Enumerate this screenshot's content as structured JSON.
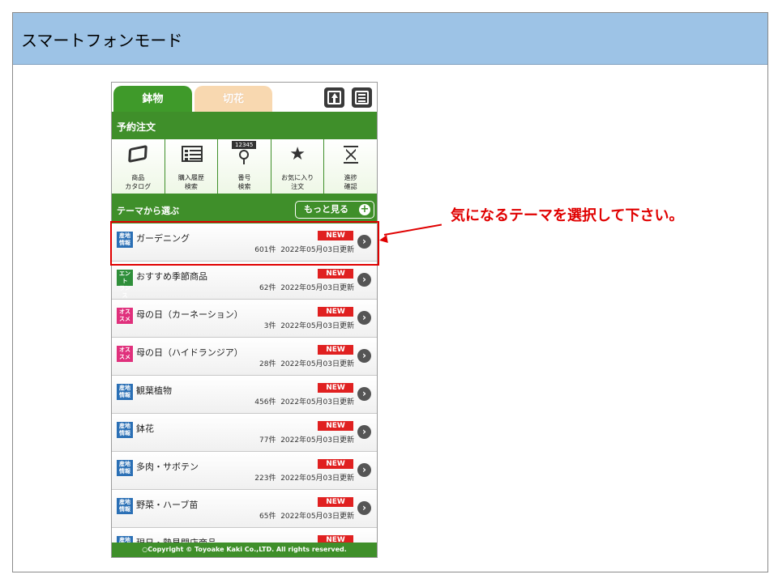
{
  "slide": {
    "title": "スマートフォンモード"
  },
  "tabs": [
    {
      "label": "鉢物",
      "active": true
    },
    {
      "label": "切花",
      "active": false
    }
  ],
  "section_title": "予約注文",
  "nav": [
    {
      "icon": "catalog-icon",
      "label_line1": "商品",
      "label_line2": "カタログ"
    },
    {
      "icon": "history-list-icon",
      "label_line1": "購入履歴",
      "label_line2": "検索"
    },
    {
      "icon": "number-search-icon",
      "num": "12345",
      "label_line1": "番号",
      "label_line2": "検索"
    },
    {
      "icon": "star-icon",
      "label_line1": "お気に入り",
      "label_line2": "注文"
    },
    {
      "icon": "hourglass-icon",
      "label_line1": "進捗",
      "label_line2": "確認"
    }
  ],
  "theme": {
    "label": "テーマから選ぶ",
    "more_label": "もっと見る"
  },
  "items": [
    {
      "badge": "産地情報",
      "badge_line1": "産地",
      "badge_line2": "情報",
      "badge_color": "#2a6fb5",
      "title": "ガーデニング",
      "count": "601件",
      "date": "2022年05月03日更新",
      "new": "NEW"
    },
    {
      "badge": "エントランス",
      "badge_line1": "エント",
      "badge_line2": "ランス",
      "badge_color": "#2f8f3a",
      "title": "おすすめ季節商品",
      "count": "62件",
      "date": "2022年05月03日更新",
      "new": "NEW"
    },
    {
      "badge": "オススメ",
      "badge_line1": "オス",
      "badge_line2": "スメ",
      "badge_color": "#e0307c",
      "title": "母の日（カーネーション）",
      "count": "3件",
      "date": "2022年05月03日更新",
      "new": "NEW"
    },
    {
      "badge": "オススメ",
      "badge_line1": "オス",
      "badge_line2": "スメ",
      "badge_color": "#e0307c",
      "title": "母の日（ハイドランジア）",
      "count": "28件",
      "date": "2022年05月03日更新",
      "new": "NEW"
    },
    {
      "badge": "産地情報",
      "badge_line1": "産地",
      "badge_line2": "情報",
      "badge_color": "#2a6fb5",
      "title": "観葉植物",
      "count": "456件",
      "date": "2022年05月03日更新",
      "new": "NEW"
    },
    {
      "badge": "産地情報",
      "badge_line1": "産地",
      "badge_line2": "情報",
      "badge_color": "#2a6fb5",
      "title": "鉢花",
      "count": "77件",
      "date": "2022年05月03日更新",
      "new": "NEW"
    },
    {
      "badge": "産地情報",
      "badge_line1": "産地",
      "badge_line2": "情報",
      "badge_color": "#2a6fb5",
      "title": "多肉・サボテン",
      "count": "223件",
      "date": "2022年05月03日更新",
      "new": "NEW"
    },
    {
      "badge": "産地情報",
      "badge_line1": "産地",
      "badge_line2": "情報",
      "badge_color": "#2a6fb5",
      "title": "野菜・ハーブ苗",
      "count": "65件",
      "date": "2022年05月03日更新",
      "new": "NEW"
    },
    {
      "badge": "産地情報",
      "badge_line1": "産地",
      "badge_line2": "情報",
      "badge_color": "#2a6fb5",
      "title": "現日・勢見開店商品",
      "count": "",
      "date": "",
      "new": "NEW"
    }
  ],
  "footer": "○Copyright © Toyoake Kaki Co.,LTD. All rights reserved.",
  "callout": "気になるテーマを選択して下さい。",
  "colors": {
    "brand_green": "#3f8f2a",
    "new_red": "#e02020",
    "annotation_red": "#e00000",
    "header_blue": "#9dc3e6"
  }
}
